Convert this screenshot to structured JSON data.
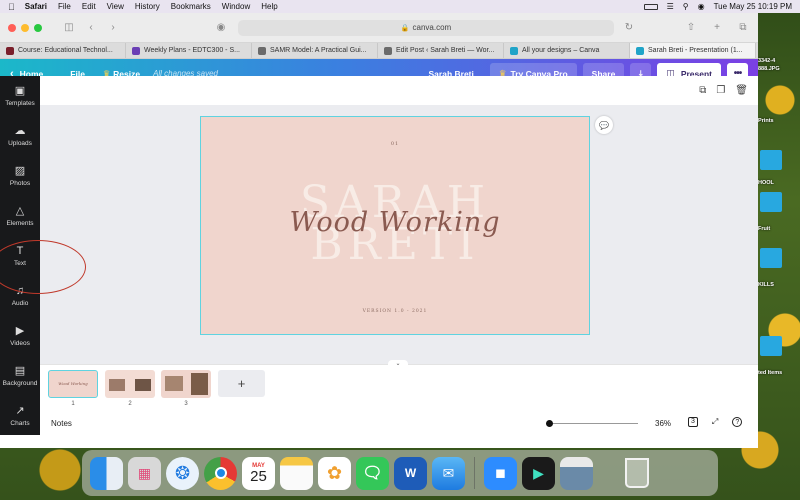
{
  "menubar": {
    "app": "Safari",
    "items": [
      "File",
      "Edit",
      "View",
      "History",
      "Bookmarks",
      "Window",
      "Help"
    ],
    "datetime": "Tue May 25  10:19 PM"
  },
  "browser": {
    "url": "canva.com",
    "tabs": [
      {
        "title": "Course: Educational Technol...",
        "color": "#7a1f2b"
      },
      {
        "title": "Weekly Plans - EDTC300 - S...",
        "color": "#6a3fb5"
      },
      {
        "title": "SAMR Model: A Practical Gui...",
        "color": "#6b6b6b"
      },
      {
        "title": "Edit Post ‹ Sarah Breti — Wor...",
        "color": "#6b6b6b"
      },
      {
        "title": "All your designs – Canva",
        "color": "#20a4c8"
      },
      {
        "title": "Sarah Breti - Presentation (1...",
        "color": "#20a4c8"
      }
    ]
  },
  "canva": {
    "home": "Home",
    "file": "File",
    "resize": "Resize",
    "saved_status": "All changes saved",
    "user_name": "Sarah Breti",
    "try_pro": "Try Canva Pro",
    "share": "Share",
    "present": "Present",
    "sidebar": [
      {
        "label": "Templates",
        "icon": "templates-icon"
      },
      {
        "label": "Uploads",
        "icon": "uploads-icon"
      },
      {
        "label": "Photos",
        "icon": "photos-icon"
      },
      {
        "label": "Elements",
        "icon": "elements-icon"
      },
      {
        "label": "Text",
        "icon": "text-icon"
      },
      {
        "label": "Audio",
        "icon": "audio-icon"
      },
      {
        "label": "Videos",
        "icon": "videos-icon"
      },
      {
        "label": "Background",
        "icon": "background-icon"
      },
      {
        "label": "Charts",
        "icon": "charts-icon"
      }
    ],
    "slide": {
      "number": "01",
      "big_line1": "SARAH",
      "big_line2": "BRETI",
      "script": "Wood Working",
      "version": "VERSION 1.0 - 2021"
    },
    "pages": [
      "1",
      "2",
      "3"
    ],
    "add_page": "+",
    "notes": "Notes",
    "zoom": 0.36,
    "zoom_label": "36%",
    "page_count": "3"
  },
  "desktop": {
    "labels": [
      "3342-4",
      "888.JPG",
      "Prints",
      "HOOL",
      "Fruit",
      "KILLS",
      "ted Items"
    ]
  },
  "dock": {
    "calendar_month": "MAY",
    "calendar_day": "25"
  },
  "colors": {
    "slide_bg": "#f0d5cd",
    "selection": "#5fd3e0",
    "annotation": "#c0392b"
  }
}
